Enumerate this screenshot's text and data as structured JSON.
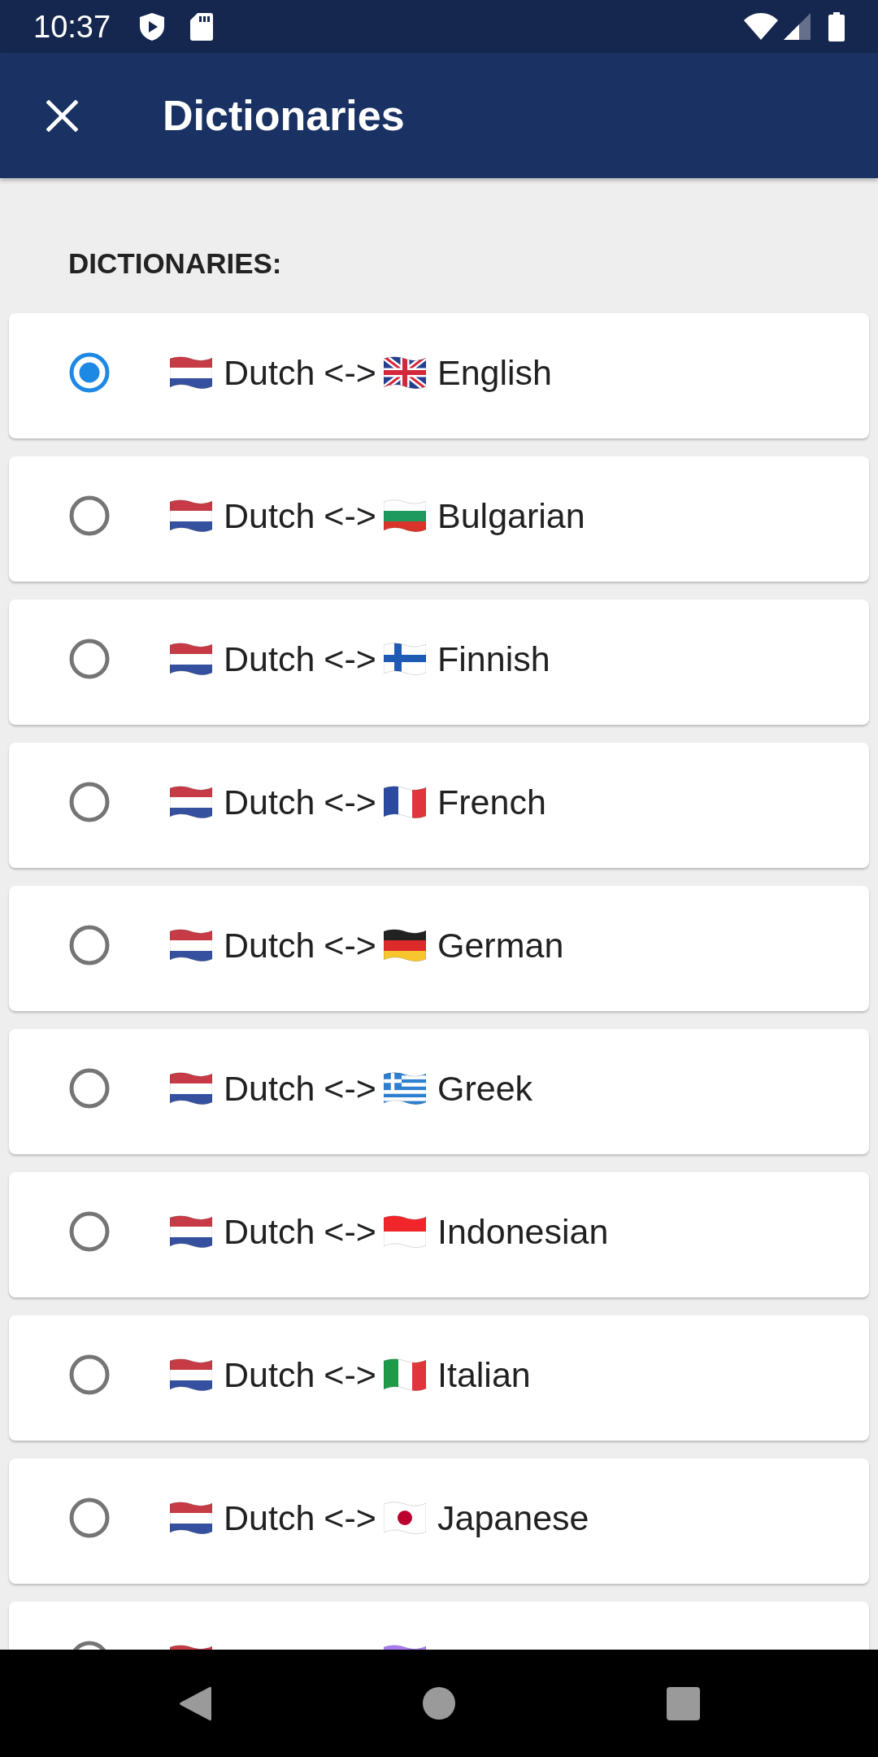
{
  "status_bar": {
    "time": "10:37"
  },
  "app_bar": {
    "title": "Dictionaries"
  },
  "list_header": "DICTIONARIES:",
  "dictionaries": [
    {
      "selected": true,
      "from_flag": {
        "kind": "netherlands"
      },
      "from": "Dutch",
      "arrow": "<->",
      "to_flag": {
        "kind": "united_kingdom"
      },
      "to": "English"
    },
    {
      "selected": false,
      "from_flag": {
        "kind": "netherlands"
      },
      "from": "Dutch",
      "arrow": "<->",
      "to_flag": {
        "kind": "bulgaria"
      },
      "to": "Bulgarian"
    },
    {
      "selected": false,
      "from_flag": {
        "kind": "netherlands"
      },
      "from": "Dutch",
      "arrow": "<->",
      "to_flag": {
        "kind": "finland"
      },
      "to": "Finnish"
    },
    {
      "selected": false,
      "from_flag": {
        "kind": "netherlands"
      },
      "from": "Dutch",
      "arrow": "<->",
      "to_flag": {
        "kind": "france"
      },
      "to": "French"
    },
    {
      "selected": false,
      "from_flag": {
        "kind": "netherlands"
      },
      "from": "Dutch",
      "arrow": "<->",
      "to_flag": {
        "kind": "germany"
      },
      "to": "German"
    },
    {
      "selected": false,
      "from_flag": {
        "kind": "netherlands"
      },
      "from": "Dutch",
      "arrow": "<->",
      "to_flag": {
        "kind": "greece"
      },
      "to": "Greek"
    },
    {
      "selected": false,
      "from_flag": {
        "kind": "netherlands"
      },
      "from": "Dutch",
      "arrow": "<->",
      "to_flag": {
        "kind": "indonesia"
      },
      "to": "Indonesian"
    },
    {
      "selected": false,
      "from_flag": {
        "kind": "netherlands"
      },
      "from": "Dutch",
      "arrow": "<->",
      "to_flag": {
        "kind": "italy"
      },
      "to": "Italian"
    },
    {
      "selected": false,
      "from_flag": {
        "kind": "netherlands"
      },
      "from": "Dutch",
      "arrow": "<->",
      "to_flag": {
        "kind": "japan"
      },
      "to": "Japanese"
    },
    {
      "selected": false,
      "from_flag": {
        "kind": "netherlands"
      },
      "to_flag": {
        "kind": "other"
      }
    }
  ]
}
